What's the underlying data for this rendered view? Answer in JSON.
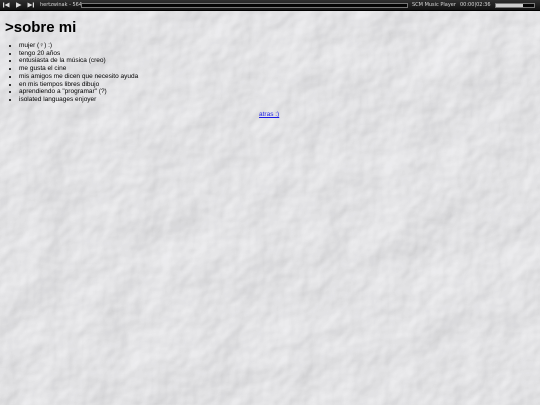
{
  "player": {
    "track_title": "hertzwinak - 564",
    "player_name": "SCM Music Player",
    "time": "00:00|02:36",
    "progress": 0.0,
    "volume": 0.7
  },
  "page": {
    "title": ">sobre mi",
    "items": [
      "mujer (♀) :)",
      "tengo 20 años",
      "entusiasta de la música (creo)",
      "me gusta el cine",
      "mis amigos me dicen que necesito ayuda",
      "en mis tiempos libres dibujo",
      "aprendiendo a \"programar\" (?)",
      "isolated languages enjoyer"
    ],
    "back_link": "atras :)"
  },
  "icons": {
    "prev": "skip-back-icon",
    "play": "play-icon",
    "next": "skip-forward-icon"
  },
  "colors": {
    "player_bg": "#1c1c1c",
    "link": "#1a1ae6",
    "paper": "#ecedef"
  }
}
